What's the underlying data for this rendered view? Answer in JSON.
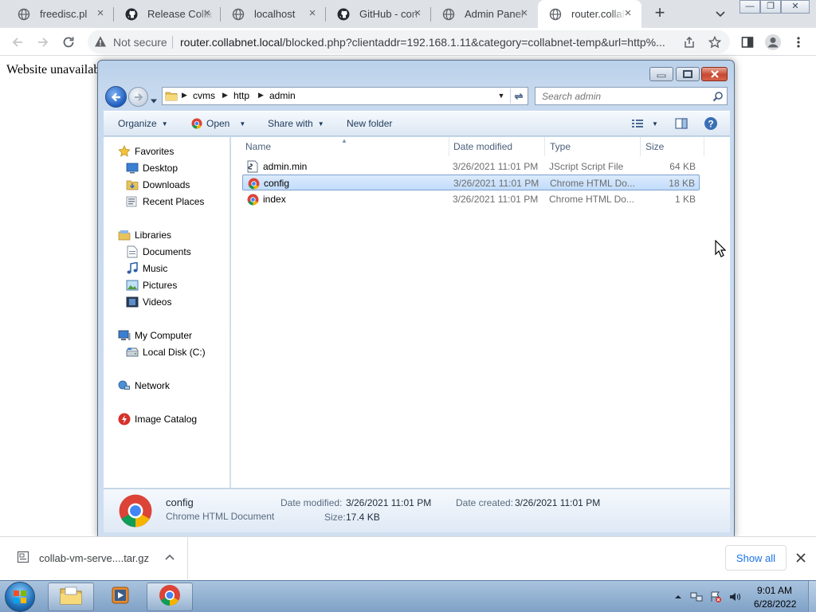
{
  "browser": {
    "tabs": [
      {
        "title": "freedisc.pl",
        "icon": "globe-icon"
      },
      {
        "title": "Release Colla",
        "icon": "github-icon"
      },
      {
        "title": "localhost",
        "icon": "globe-icon"
      },
      {
        "title": "GitHub - con",
        "icon": "github-icon"
      },
      {
        "title": "Admin Panel",
        "icon": "globe-icon"
      },
      {
        "title": "router.collab",
        "icon": "globe-icon",
        "active": true
      }
    ],
    "security_label": "Not secure",
    "url_host": "router.collabnet.local",
    "url_path": "/blocked.php?clientaddr=192.168.1.11&category=collabnet-temp&url=http%..."
  },
  "page": {
    "text": "Website unavailab"
  },
  "explorer": {
    "breadcrumbs": [
      "cvms",
      "http",
      "admin"
    ],
    "search_placeholder": "Search admin",
    "commands": {
      "organize": "Organize",
      "open": "Open",
      "share_with": "Share with",
      "new_folder": "New folder"
    },
    "nav_groups": [
      {
        "label": "Favorites",
        "icon": "star-icon",
        "items": [
          {
            "label": "Desktop",
            "icon": "desktop-icon"
          },
          {
            "label": "Downloads",
            "icon": "downloads-folder-icon"
          },
          {
            "label": "Recent Places",
            "icon": "recent-places-icon"
          }
        ]
      },
      {
        "label": "Libraries",
        "icon": "libraries-icon",
        "items": [
          {
            "label": "Documents",
            "icon": "documents-icon"
          },
          {
            "label": "Music",
            "icon": "music-icon"
          },
          {
            "label": "Pictures",
            "icon": "pictures-icon"
          },
          {
            "label": "Videos",
            "icon": "videos-icon"
          }
        ]
      },
      {
        "label": "My Computer",
        "icon": "computer-icon",
        "items": [
          {
            "label": "Local Disk (C:)",
            "icon": "drive-icon"
          }
        ]
      },
      {
        "label": "Network",
        "icon": "network-icon",
        "items": []
      },
      {
        "label": "Image Catalog",
        "icon": "image-catalog-icon",
        "items": []
      }
    ],
    "columns": [
      "Name",
      "Date modified",
      "Type",
      "Size"
    ],
    "files": [
      {
        "name": "admin.min",
        "date": "3/26/2021 11:01 PM",
        "type": "JScript Script File",
        "size": "64 KB",
        "icon": "script-file-icon",
        "selected": false
      },
      {
        "name": "config",
        "date": "3/26/2021 11:01 PM",
        "type": "Chrome HTML Do...",
        "size": "18 KB",
        "icon": "chrome-html-icon",
        "selected": true
      },
      {
        "name": "index",
        "date": "3/26/2021 11:01 PM",
        "type": "Chrome HTML Do...",
        "size": "1 KB",
        "icon": "chrome-html-icon",
        "selected": false
      }
    ],
    "details": {
      "name": "config",
      "type": "Chrome HTML Document",
      "date_modified_label": "Date modified:",
      "date_modified": "3/26/2021 11:01 PM",
      "date_created_label": "Date created:",
      "date_created": "3/26/2021 11:01 PM",
      "size_label": "Size:",
      "size": "17.4 KB"
    }
  },
  "downloads": {
    "file": "collab-vm-serve....tar.gz",
    "show_all": "Show all"
  },
  "taskbar": {
    "time": "9:01 AM",
    "date": "6/28/2022"
  },
  "colors": {
    "chrome_tabstrip": "#dee1e6",
    "link_blue": "#1a73e8",
    "selection": "#c1dcfc",
    "taskbar": "#8fb0d4"
  }
}
